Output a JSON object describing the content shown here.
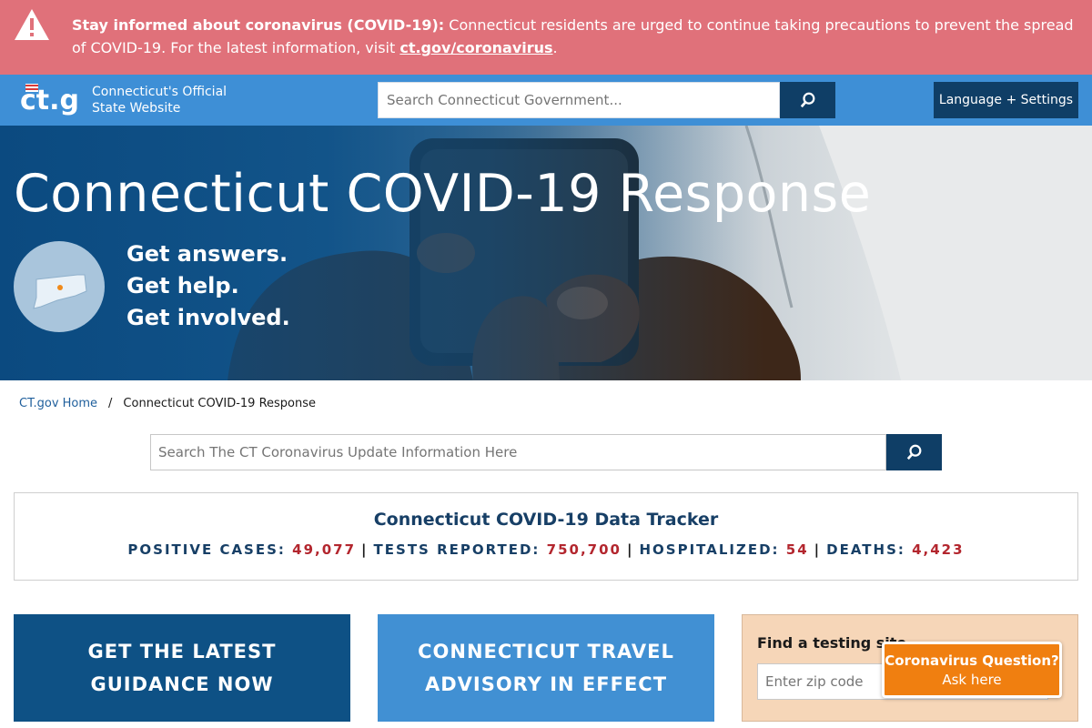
{
  "alert": {
    "bold": "Stay informed about coronavirus (COVID-19):",
    "text": " Connecticut residents are urged to continue taking precautions to prevent the spread of COVID-19. For the latest information, visit ",
    "link": "ct.gov/coronavirus",
    "end": "."
  },
  "header": {
    "logo_text": "ct.gov",
    "tagline_line1": "Connecticut's Official",
    "tagline_line2": "State Website",
    "search_placeholder": "Search Connecticut Government...",
    "language_button": "Language + Settings"
  },
  "hero": {
    "title": "Connecticut COVID-19 Response",
    "line1": "Get answers.",
    "line2": "Get help.",
    "line3": "Get involved."
  },
  "breadcrumb": {
    "home": "CT.gov Home",
    "separator": "/",
    "current": "Connecticut COVID-19 Response"
  },
  "local_search": {
    "placeholder": "Search The CT Coronavirus Update Information Here"
  },
  "tracker": {
    "title": "Connecticut COVID-19 Data Tracker",
    "positive_label": "POSITIVE CASES:",
    "positive_value": "49,077",
    "tests_label": "TESTS REPORTED:",
    "tests_value": "750,700",
    "hospital_label": "HOSPITALIZED:",
    "hospital_value": "54",
    "deaths_label": "DEATHS:",
    "deaths_value": "4,423",
    "divider": "|"
  },
  "tiles": {
    "guidance_line1": "GET THE LATEST",
    "guidance_line2": "GUIDANCE NOW",
    "travel_line1": "CONNECTICUT TRAVEL",
    "travel_line2": "ADVISORY IN EFFECT"
  },
  "testing": {
    "label": "Find a testing site",
    "zip_placeholder": "Enter zip code"
  },
  "chat": {
    "line1": "Coronavirus Question?",
    "line2": "Ask here"
  },
  "colors": {
    "alert_bg": "#e0717a",
    "header_bg": "#3e8fd6",
    "dark_blue": "#0f3e66",
    "tile_dark": "#0e5185",
    "tile_light": "#4190d3",
    "stat_red": "#b3262e",
    "chat_orange": "#f07f10"
  }
}
